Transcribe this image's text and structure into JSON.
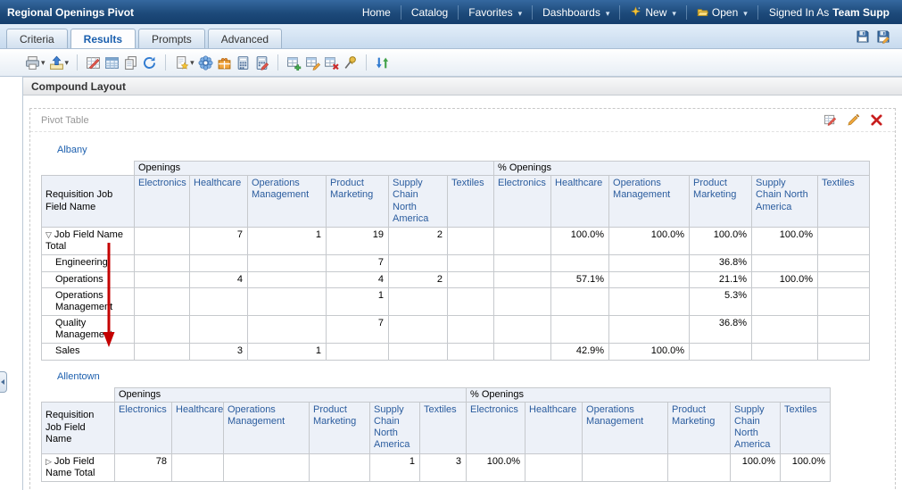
{
  "topbar": {
    "title": "Regional Openings Pivot",
    "nav": [
      {
        "label": "Home",
        "dropdown": false
      },
      {
        "label": "Catalog",
        "dropdown": false
      },
      {
        "label": "Favorites",
        "dropdown": true
      },
      {
        "label": "Dashboards",
        "dropdown": true
      },
      {
        "label": "New",
        "dropdown": true,
        "icon": "new-sparkle-icon"
      },
      {
        "label": "Open",
        "dropdown": true,
        "icon": "open-folder-icon"
      }
    ],
    "signed_in_prefix": "Signed In As",
    "signed_in_user": "Team Supp"
  },
  "tabs": {
    "items": [
      "Criteria",
      "Results",
      "Prompts",
      "Advanced"
    ],
    "active": "Results",
    "actions": [
      "save-icon",
      "save-as-icon"
    ]
  },
  "toolbar": {
    "icons": [
      "print-icon",
      "export-icon",
      "show-results-icon",
      "view-sql-icon",
      "copy-icon",
      "refresh-icon",
      "new-view-icon",
      "preview-icon",
      "new-calculated-item-icon",
      "new-calculated-measure-icon",
      "edit-calculated-measure-icon",
      "new-group-icon",
      "edit-group-icon",
      "remove-group-icon",
      "freeze-icon",
      "sort-icon"
    ]
  },
  "section": {
    "title": "Compound Layout"
  },
  "panel": {
    "title": "Pivot Table",
    "actions": [
      "view-properties-icon",
      "edit-view-icon",
      "remove-view-icon"
    ]
  },
  "measure_labels": [
    "Openings",
    "% Openings"
  ],
  "pivots": [
    {
      "region": "Albany",
      "row_header": "Requisition Job Field Name",
      "columns": [
        "Electronics",
        "Healthcare",
        "Operations Management",
        "Product Marketing",
        "Supply Chain North America",
        "Textiles"
      ],
      "rows": [
        {
          "toggle": "▽",
          "label": "Job Field Name Total",
          "indent": false,
          "openings": [
            "",
            "7",
            "1",
            "19",
            "2",
            ""
          ],
          "pct_openings": [
            "",
            "100.0%",
            "100.0%",
            "100.0%",
            "100.0%",
            ""
          ]
        },
        {
          "toggle": "",
          "label": "Engineering",
          "indent": true,
          "openings": [
            "",
            "",
            "",
            "7",
            "",
            ""
          ],
          "pct_openings": [
            "",
            "",
            "",
            "36.8%",
            "",
            ""
          ]
        },
        {
          "toggle": "",
          "label": "Operations",
          "indent": true,
          "openings": [
            "",
            "4",
            "",
            "4",
            "2",
            ""
          ],
          "pct_openings": [
            "",
            "57.1%",
            "",
            "21.1%",
            "100.0%",
            ""
          ]
        },
        {
          "toggle": "",
          "label": "Operations Management",
          "indent": true,
          "openings": [
            "",
            "",
            "",
            "1",
            "",
            ""
          ],
          "pct_openings": [
            "",
            "",
            "",
            "5.3%",
            "",
            ""
          ]
        },
        {
          "toggle": "",
          "label": "Quality Management",
          "indent": true,
          "openings": [
            "",
            "",
            "",
            "7",
            "",
            ""
          ],
          "pct_openings": [
            "",
            "",
            "",
            "36.8%",
            "",
            ""
          ]
        },
        {
          "toggle": "",
          "label": "Sales",
          "indent": true,
          "openings": [
            "",
            "3",
            "1",
            "",
            "",
            ""
          ],
          "pct_openings": [
            "",
            "42.9%",
            "100.0%",
            "",
            "",
            ""
          ]
        }
      ]
    },
    {
      "region": "Allentown",
      "row_header": "Requisition Job Field Name",
      "columns": [
        "Electronics",
        "Healthcare",
        "Operations Management",
        "Product Marketing",
        "Supply Chain North America",
        "Textiles"
      ],
      "rows": [
        {
          "toggle": "▷",
          "label": "Job Field Name Total",
          "indent": false,
          "openings": [
            "78",
            "",
            "",
            "",
            "1",
            "3"
          ],
          "pct_openings": [
            "100.0%",
            "",
            "",
            "",
            "100.0%",
            "100.0%"
          ]
        }
      ]
    }
  ],
  "annotation": {
    "arrow_color": "#c40000"
  }
}
